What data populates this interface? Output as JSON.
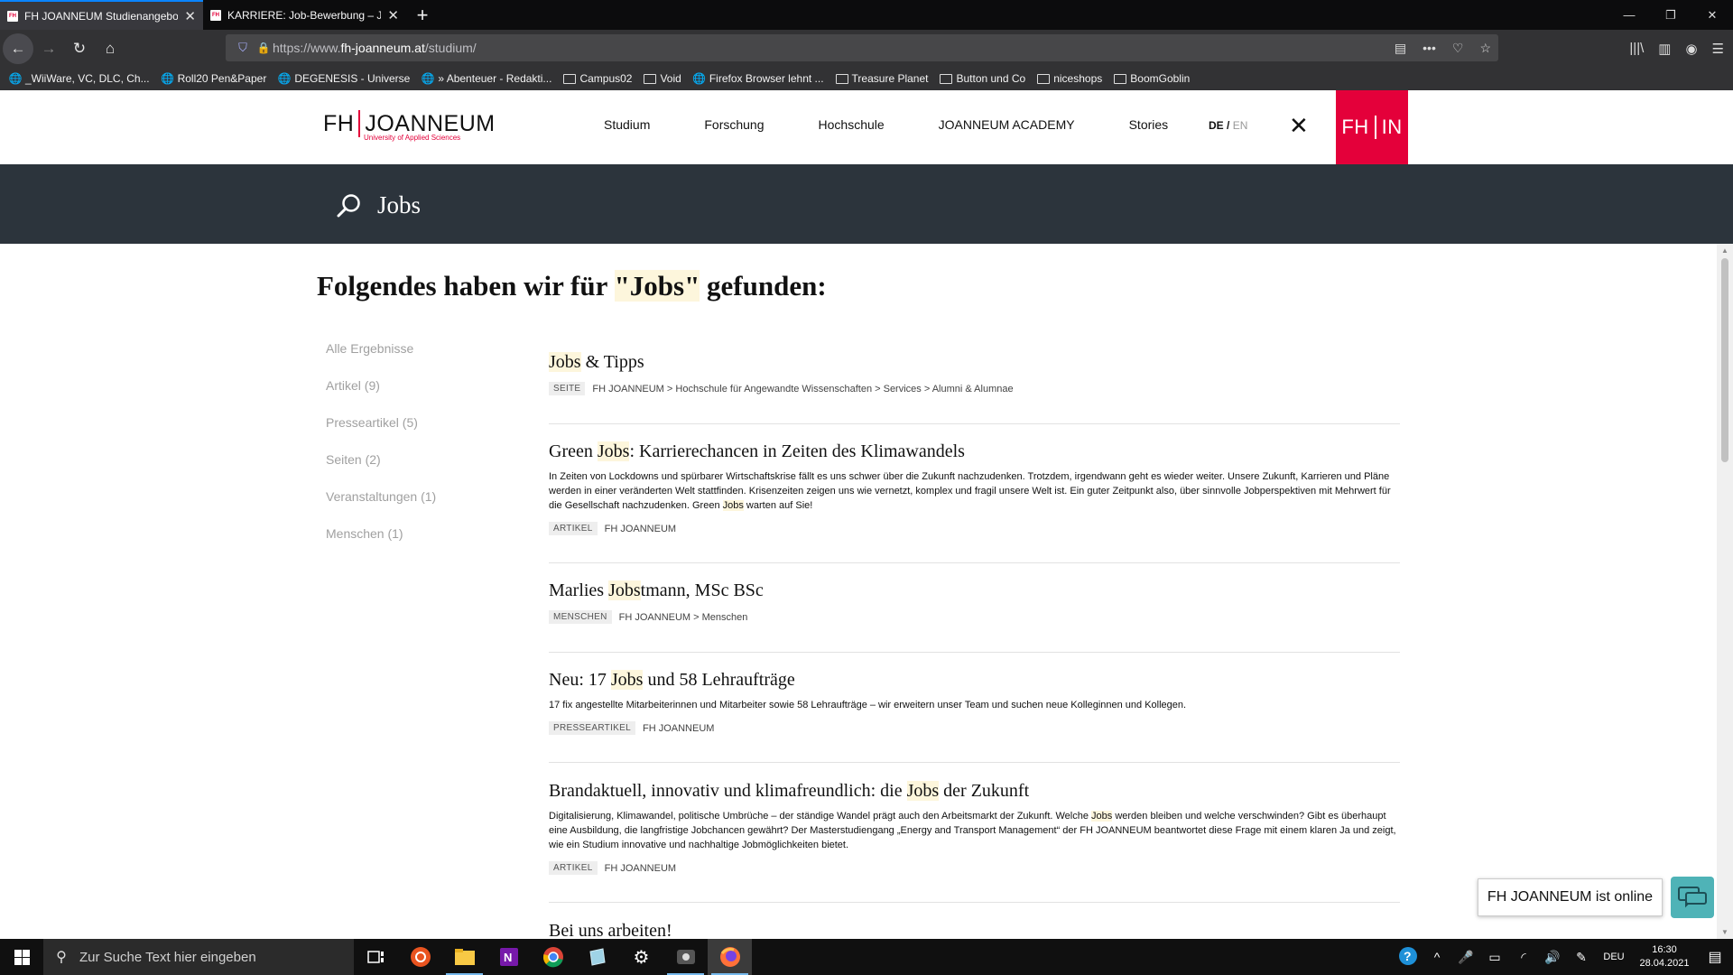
{
  "browser": {
    "tabs": [
      {
        "title": "FH JOANNEUM Studienangebot"
      },
      {
        "title": "KARRIERE: Job-Bewerbung – JOANNEUM"
      }
    ],
    "url_prefix": "https://www.",
    "url_domain": "fh-joanneum.at",
    "url_path": "/studium/",
    "bookmarks": [
      "_WiiWare, VC, DLC, Ch...",
      "Roll20 Pen&Paper",
      "DEGENESIS - Universe",
      "» Abenteuer - Redakti...",
      "Campus02",
      "Void",
      "Firefox Browser lehnt ...",
      "Treasure Planet",
      "Button und Co",
      "niceshops",
      "BoomGoblin"
    ]
  },
  "site": {
    "logo_fh": "FH",
    "logo_joanneum": "JOANNEUM",
    "logo_sub": "University of Applied Sciences",
    "nav": [
      "Studium",
      "Forschung",
      "Hochschule",
      "JOANNEUM ACADEMY",
      "Stories"
    ],
    "lang_de": "DE",
    "lang_sep": "/",
    "lang_en": "EN",
    "close": "✕",
    "fhin_left": "FH",
    "fhin_right": "IN"
  },
  "search": {
    "query": "Jobs"
  },
  "heading": {
    "pre": "Folgendes haben wir für ",
    "term": "\"Jobs\"",
    "post": " gefunden:"
  },
  "filters": [
    "Alle Ergebnisse",
    "Artikel (9)",
    "Presseartikel (5)",
    "Seiten (2)",
    "Veranstaltungen (1)",
    "Menschen (1)"
  ],
  "results": [
    {
      "title_hl": "Jobs",
      "title_rest": " & Tipps",
      "type": "SEITE",
      "path": "FH JOANNEUM > Hochschule für Angewandte Wissenschaften > Services > Alumni & Alumnae"
    },
    {
      "title_pre": "Green ",
      "title_hl": "Jobs",
      "title_rest": ": Karrierechancen in Zeiten des Klimawandels",
      "desc_pre": "In Zeiten von Lockdowns und spürbarer Wirtschaftskrise fällt es uns schwer über die Zukunft nachzudenken. Trotzdem, irgendwann geht es wieder weiter. Unsere Zukunft, Karrieren und Pläne werden in einer veränderten Welt stattfinden. Krisenzeiten zeigen uns wie vernetzt, komplex und fragil unsere Welt ist. Ein guter Zeitpunkt also, über sinnvolle Jobperspektiven mit Mehrwert für die Gesellschaft nachzudenken. Green ",
      "desc_hl": "Jobs",
      "desc_post": " warten auf Sie!",
      "type": "ARTIKEL",
      "path": "FH JOANNEUM"
    },
    {
      "title_pre": "Marlies ",
      "title_hl": "Jobs",
      "title_rest": "tmann, MSc BSc",
      "type": "MENSCHEN",
      "path": "FH JOANNEUM > Menschen"
    },
    {
      "title_pre": "Neu: 17 ",
      "title_hl": "Jobs",
      "title_rest": " und 58 Lehraufträge",
      "desc": "17 fix angestellte Mitarbeiterinnen und Mitarbeiter sowie 58 Lehraufträge – wir erweitern unser Team und suchen neue Kolleginnen und Kollegen.",
      "type": "PRESSEARTIKEL",
      "path": "FH JOANNEUM"
    },
    {
      "title_pre": "Brandaktuell, innovativ und klimafreundlich: die ",
      "title_hl": "Jobs",
      "title_rest": " der Zukunft",
      "desc_pre": "Digitalisierung, Klimawandel, politische Umbrüche – der ständige Wandel prägt auch den Arbeitsmarkt der Zukunft. Welche ",
      "desc_hl": "Jobs",
      "desc_post": " werden bleiben und welche verschwinden? Gibt es überhaupt eine Ausbildung, die langfristige Jobchancen gewährt? Der Masterstudiengang „Energy and Transport Management“ der FH JOANNEUM beantwortet diese Frage mit einem klaren Ja und zeigt, wie ein Studium innovative und nachhaltige Jobmöglichkeiten bietet.",
      "type": "ARTIKEL",
      "path": "FH JOANNEUM"
    },
    {
      "title": "Bei uns arbeiten!"
    }
  ],
  "chat": {
    "label": "FH JOANNEUM ist online"
  },
  "taskbar": {
    "search_placeholder": "Zur Suche Text hier eingeben",
    "lang": "DEU",
    "time": "16:30",
    "date": "28.04.2021"
  },
  "colors": {
    "brand_red": "#e4003a",
    "search_band": "#2c343c",
    "highlight": "#fdf6dc",
    "chat_teal": "#4fb3b7"
  }
}
